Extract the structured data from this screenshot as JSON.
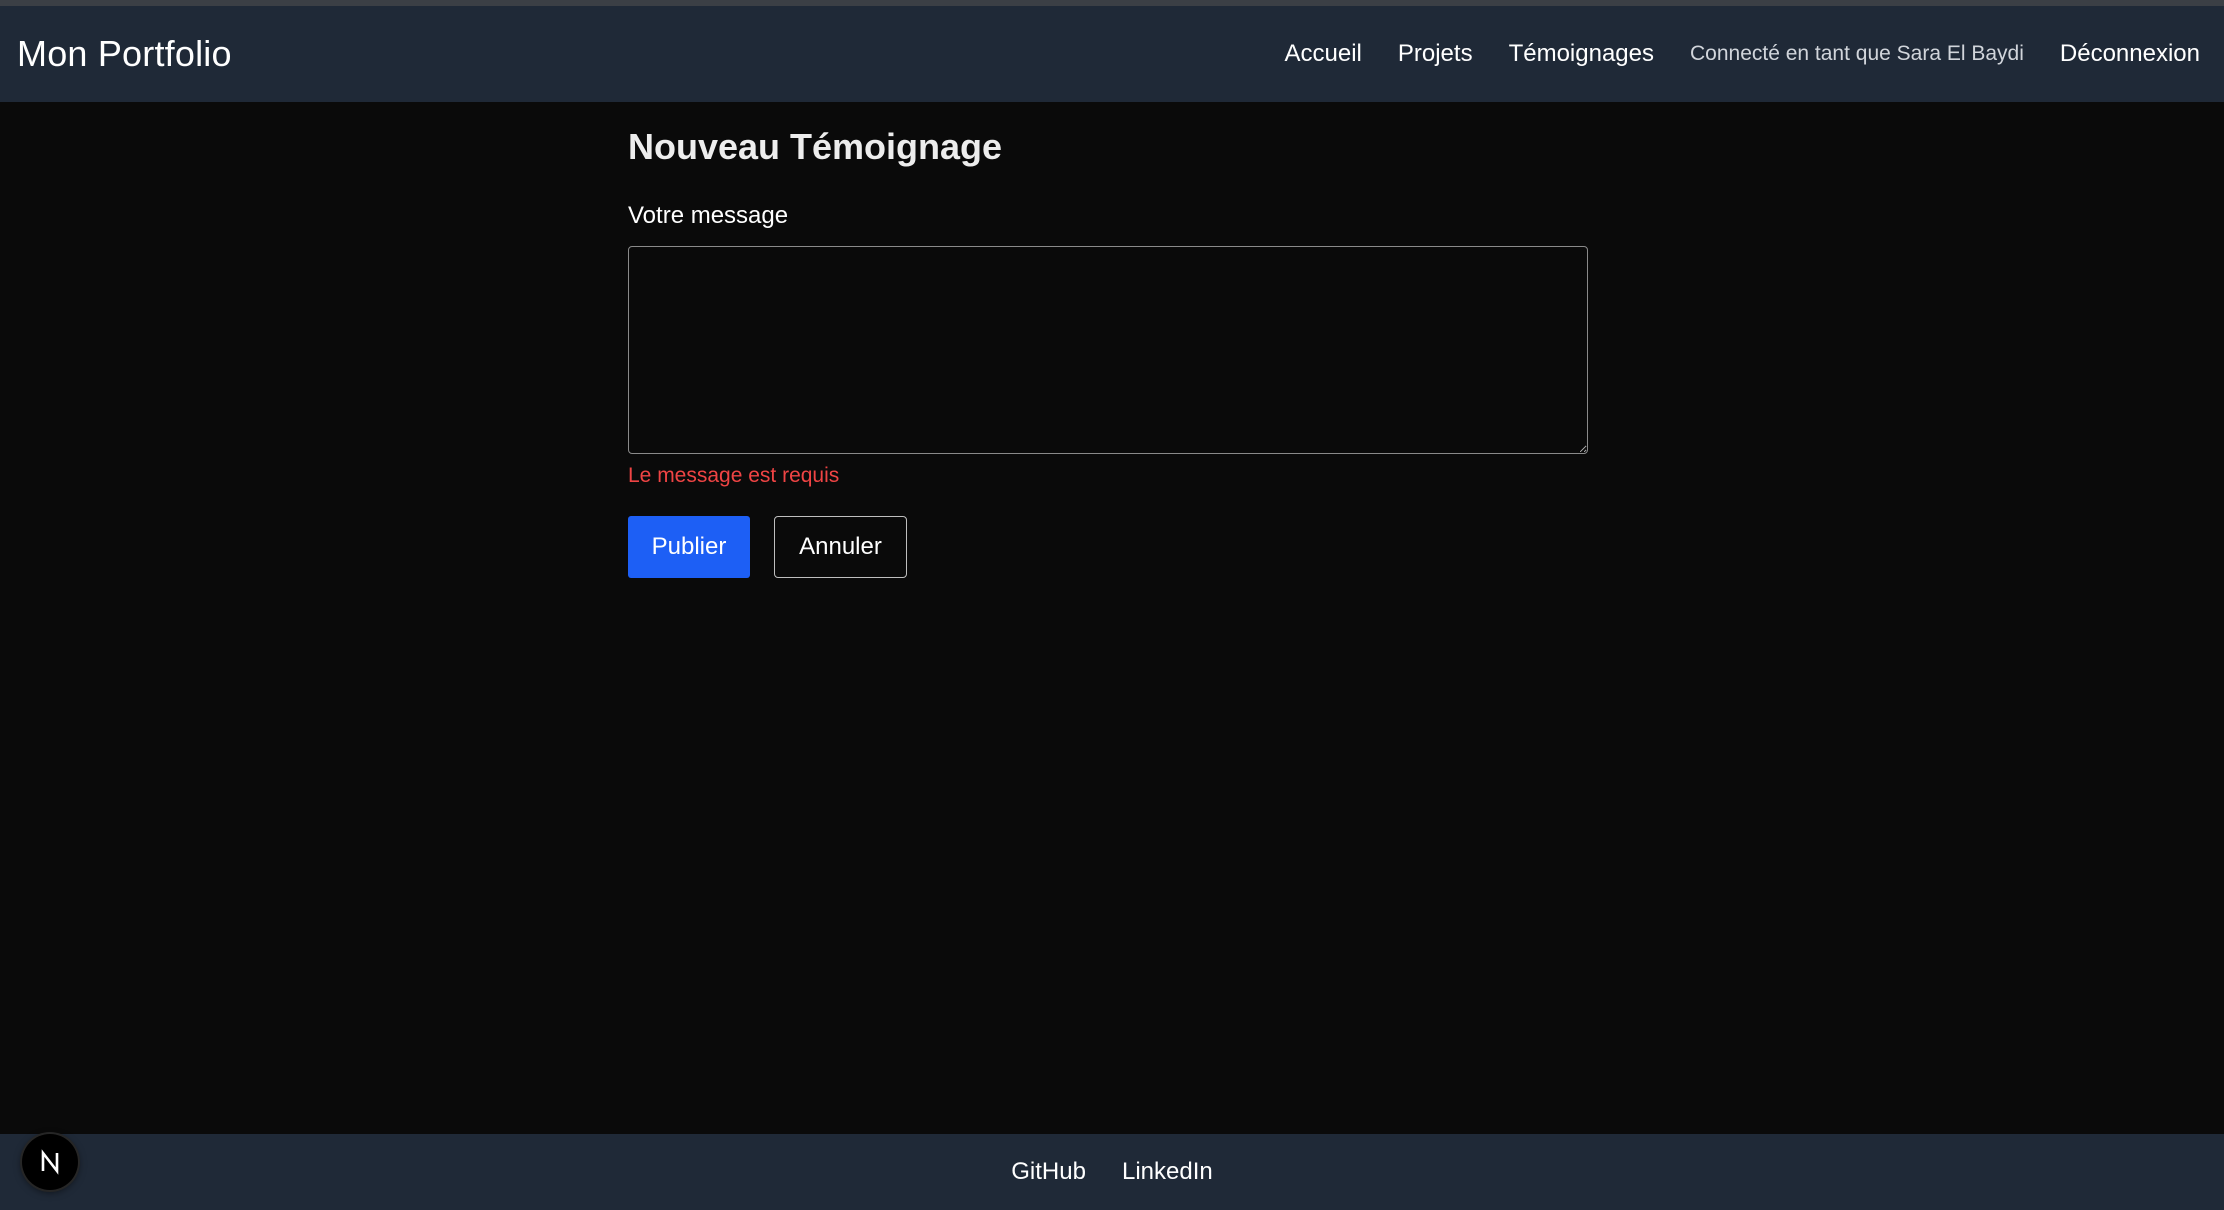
{
  "navbar": {
    "brand": "Mon Portfolio",
    "links": [
      "Accueil",
      "Projets",
      "Témoignages"
    ],
    "user_status": "Connecté en tant que Sara El Baydi",
    "logout": "Déconnexion"
  },
  "form": {
    "title": "Nouveau Témoignage",
    "message_label": "Votre message",
    "message_value": "",
    "error": "Le message est requis",
    "submit_label": "Publier",
    "cancel_label": "Annuler"
  },
  "footer": {
    "links": [
      "GitHub",
      "LinkedIn"
    ]
  },
  "dev_indicator": {
    "letter": "N",
    "icon": "nextjs-logo-icon"
  },
  "colors": {
    "background": "#0a0a0a",
    "navbar": "#1f2937",
    "primary": "#1d5ff5",
    "error": "#ef4444"
  }
}
